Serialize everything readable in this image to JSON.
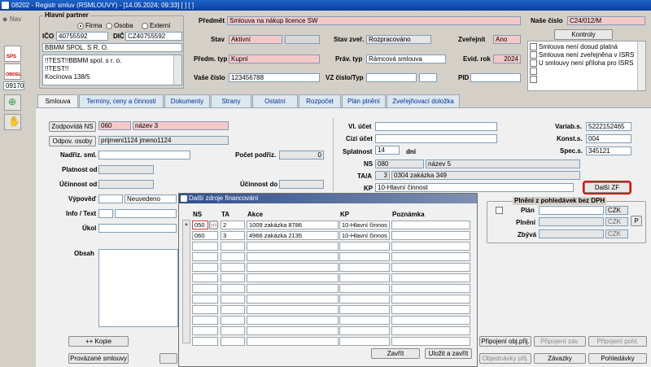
{
  "window": {
    "title": "08202 - Registr smluv (RSMLOUVY) - [14.05.2024; 09:33] [ ] [ ]"
  },
  "nav": {
    "label": "Nav",
    "code": "09170"
  },
  "sidebar": {
    "sps_label": "SPS",
    "obdelnik_label": "OBDEL"
  },
  "partner": {
    "group_title": "Hlavní partner",
    "radio_firma": "Firma",
    "radio_osoba": "Osoba",
    "radio_externi": "Externí",
    "ico_label": "IČO",
    "ico_value": "40755592",
    "dic_label": "DIČ",
    "dic_value": "CZ40755592",
    "name_value": "BBMM SPOL. S R. O.",
    "address_lines": [
      "!!TEST!!BBMM spol. s r. o.",
      "!!TEST!!",
      "Kocínova 138/5"
    ]
  },
  "header": {
    "predmet_label": "Předmět",
    "predmet_value": "Smlouva na nákup licence SW",
    "nase_cislo_label": "Naše číslo",
    "nase_cislo_value": "C24/012/M",
    "stav_label": "Stav",
    "stav_value": "Aktivní",
    "stav_zver_label": "Stav zveř.",
    "stav_zver_value": "Rozpracováno",
    "zverejnit_label": "Zveřejnit",
    "zverejnit_value": "Ano",
    "predm_typ_label": "Předm. typ",
    "predm_typ_value": "Kupní",
    "prav_typ_label": "Práv. typ",
    "prav_typ_value": "Rámcová smlouva",
    "evid_rok_label": "Evid. rok",
    "evid_rok_value": "2024",
    "vase_cislo_label": "Vaše číslo",
    "vase_cislo_value": "123456788",
    "vz_label": "VZ číslo/Typ",
    "pid_label": "PID"
  },
  "kontroly": {
    "button_label": "Kontroly",
    "items": [
      "Smlouva není dosud platná",
      "Smlouva není zveřejněna v ISRS",
      "U smlouvy není příloha pro ISRS"
    ]
  },
  "tabs": [
    {
      "label": "Smlouva"
    },
    {
      "label": "Termíny, ceny a činnosti"
    },
    {
      "label": "Dokumenty"
    },
    {
      "label": "Strany"
    },
    {
      "label": "Ostatní"
    },
    {
      "label": "Rozpočet"
    },
    {
      "label": "Plán plnění"
    },
    {
      "label": "Zveřejňovací doložka"
    }
  ],
  "main": {
    "zodpovida_label": "Zodpovídá NS",
    "zodpovida_code": "060",
    "zodpovida_name": "název 3",
    "odpov_osoby_label": "Odpov. osoby",
    "odpov_osoby_value": "prijmeni1124 jmeno1124",
    "nadriz_label": "Nadřiz. sml.",
    "pocet_podriz_label": "Počet podřiz.",
    "pocet_podriz_value": "0",
    "platnost_label": "Platnost od",
    "ucinnost_label": "Účinnost od",
    "ucinnost_do_label": "Účinnost do",
    "vypoved_label": "Výpověď",
    "vypoved_value": "Neuvedeno",
    "info_label": "Info / Text",
    "ukol_label": "Úkol",
    "obsah_label": "Obsah",
    "vl_ucet_label": "Vl. účet",
    "cizi_ucet_label": "Cizí účet",
    "splatnost_label": "Splatnost",
    "splatnost_value": "14",
    "splatnost_unit": "dní",
    "variab_label": "Variab.s.",
    "variab_value": "5222152465",
    "konst_label": "Konst.s.",
    "konst_value": "004",
    "spec_label": "Spec.s.",
    "spec_value": "345121",
    "ns_label": "NS",
    "ns_code": "080",
    "ns_name": "název 5",
    "ta_label": "TA/A",
    "ta_code": "3",
    "ta_name": "0304 zakázka 349",
    "kp_label": "KP",
    "kp_value": "10-Hlavní činnost",
    "dalsi_zf_label": "Další ZF",
    "kopie_label": "++ Kopie",
    "provazane_label": "Provázané smlouvy"
  },
  "plneni": {
    "group_title": "Plnění z pohledávek bez DPH",
    "plan_label": "Plán",
    "plneni_label": "Plnění",
    "zbyva_label": "Zbývá",
    "currency": "CZK",
    "p_button": "P"
  },
  "bottom_buttons": {
    "pripojeni_obj": "Připojení obj.přij.",
    "pripojeni_zav": "Připojení záv.",
    "pripojeni_pohl": "Připojení pohl.",
    "objednavky": "Objednávky přij.",
    "zavazky": "Závazky",
    "pohledavky": "Pohledávky"
  },
  "dialog": {
    "title": "Další zdroje financování",
    "columns": [
      "NS",
      "TA",
      "Akce",
      "KP",
      "Poznámka"
    ],
    "rows": [
      {
        "ns": "050",
        "ta": "2",
        "akce": "1009 zakázka 8786",
        "kp": "10-Hlavní činnos",
        "poznamka": ""
      },
      {
        "ns": "060",
        "ta": "3",
        "akce": "4966 zakázka 2135",
        "kp": "10-Hlavní činnos",
        "poznamka": ""
      }
    ],
    "zavrit_label": "Zavřít",
    "ulozit_label": "Uložit a zavřít"
  }
}
